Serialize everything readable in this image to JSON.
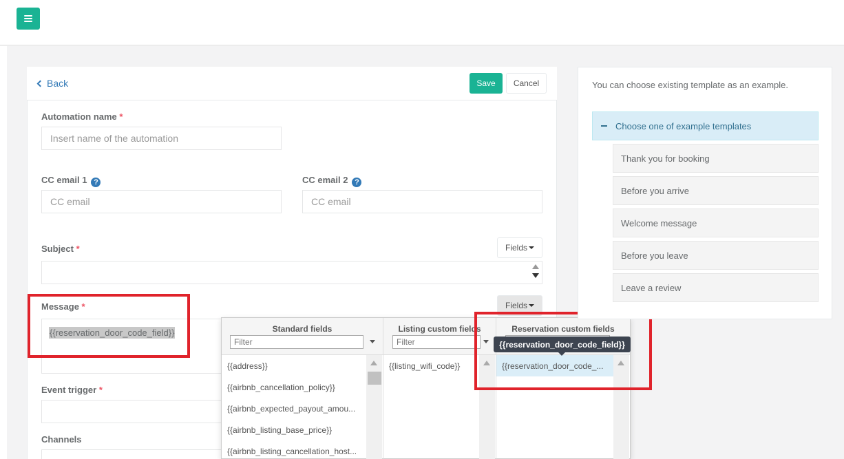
{
  "header": {
    "menu_icon": "hamburger-icon"
  },
  "form_header": {
    "back_label": "Back",
    "save_label": "Save",
    "cancel_label": "Cancel"
  },
  "form": {
    "automation_name": {
      "label": "Automation name",
      "required": "*",
      "placeholder": "Insert name of the automation"
    },
    "cc_email_1": {
      "label": "CC email 1",
      "help": "?",
      "placeholder": "CC email"
    },
    "cc_email_2": {
      "label": "CC email 2",
      "help": "?",
      "placeholder": "CC email"
    },
    "subject": {
      "label": "Subject",
      "required": "*",
      "fields_button": "Fields"
    },
    "message": {
      "label": "Message",
      "required": "*",
      "fields_button": "Fields",
      "value": "{{reservation_door_code_field}}"
    },
    "event_trigger": {
      "label": "Event trigger",
      "required": "*"
    },
    "channels": {
      "label": "Channels"
    }
  },
  "fields_dropdown": {
    "columns": [
      {
        "title": "Standard fields",
        "filter_placeholder": "Filter",
        "items": [
          "{{address}}",
          "{{airbnb_cancellation_policy}}",
          "{{airbnb_expected_payout_amou...",
          "{{airbnb_listing_base_price}}",
          "{{airbnb_listing_cancellation_host..."
        ]
      },
      {
        "title": "Listing custom fields",
        "filter_placeholder": "Filter",
        "items": [
          "{{listing_wifi_code}}"
        ]
      },
      {
        "title": "Reservation custom fields",
        "filter_placeholder": "",
        "items": [
          "{{reservation_door_code_..."
        ]
      }
    ],
    "tooltip": "{{reservation_door_code_field}}"
  },
  "examples": {
    "intro": "You can choose existing template as an example.",
    "accordion_title": "Choose one of example templates",
    "templates": [
      "Thank you for booking",
      "Before you arrive",
      "Welcome message",
      "Before you leave",
      "Leave a review"
    ]
  },
  "colors": {
    "accent": "#1ab394",
    "link": "#337ab7",
    "highlight": "#e0232b",
    "required": "#ed5565"
  }
}
